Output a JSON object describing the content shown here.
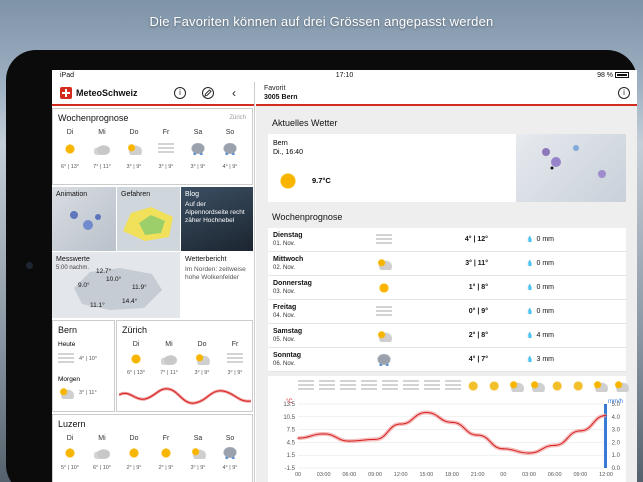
{
  "caption": "Die Favoriten können auf drei Grössen angepasst werden",
  "status": {
    "device": "iPad",
    "time": "17:10",
    "battery": "98 %"
  },
  "app": {
    "name": "MeteoSchweiz",
    "info_icon": "i",
    "edit_icon": "pencil-icon",
    "back_icon": "‹"
  },
  "wochenprognose": {
    "title": "Wochenprognose",
    "link": "Zürich",
    "days": [
      {
        "day": "Di",
        "icon": "sun",
        "temp": "6° | 13°"
      },
      {
        "day": "Mi",
        "icon": "cloud",
        "temp": "7° | 11°"
      },
      {
        "day": "Do",
        "icon": "sunc",
        "temp": "3° | 9°"
      },
      {
        "day": "Fr",
        "icon": "fog",
        "temp": "3° | 9°"
      },
      {
        "day": "Sa",
        "icon": "snow",
        "temp": "3° | 9°"
      },
      {
        "day": "So",
        "icon": "snow",
        "temp": "4° | 9°"
      }
    ]
  },
  "tiles": {
    "animation": "Animation",
    "gefahren": "Gefahren",
    "blog_title": "Blog",
    "blog_text": "Auf der Alpennordseite recht zäher Hochnebel",
    "messwerte": "Messwerte",
    "messwerte_time": "5:00 nachm.",
    "values": [
      "12.7°",
      "11.9°",
      "9.0°",
      "14.4°",
      "11.1°",
      "10.0°"
    ],
    "wetterbericht": "Wetterbericht",
    "wetterbericht_text": "Im Norden: zeitweise hohe Wolkenfelder"
  },
  "bern": {
    "title": "Bern",
    "heute": "Heute",
    "heute_temp": "4° | 10°",
    "morgen": "Morgen",
    "morgen_temp": "3° | 11°"
  },
  "zurich": {
    "title": "Zürich",
    "days": [
      "Di",
      "Mi",
      "Do",
      "Fr"
    ],
    "temps": [
      "6° | 13°",
      "7° | 11°",
      "3° | 9°",
      "3° | 9°"
    ]
  },
  "luzern": {
    "title": "Luzern",
    "days": [
      "Di",
      "Mi",
      "Do",
      "Fr",
      "Sa",
      "So"
    ],
    "temps": [
      "5° | 10°",
      "6° | 10°",
      "2° | 9°",
      "2° | 9°",
      "3° | 9°",
      "4° | 9°"
    ]
  },
  "right": {
    "fav_label": "Favorit",
    "fav_name": "3005 Bern",
    "aktuell_title": "Aktuelles Wetter",
    "aktuell_loc": "Bern",
    "aktuell_time": "Di., 16:40",
    "aktuell_temp": "9.7°C",
    "woche_title": "Wochenprognose",
    "rows": [
      {
        "day": "Dienstag",
        "date": "01. Nov.",
        "icon": "fog",
        "temp": "4° | 12°",
        "precip": "0 mm"
      },
      {
        "day": "Mittwoch",
        "date": "02. Nov.",
        "icon": "sunc",
        "temp": "3° | 11°",
        "precip": "0 mm"
      },
      {
        "day": "Donnerstag",
        "date": "03. Nov.",
        "icon": "sun",
        "temp": "1° | 8°",
        "precip": "0 mm"
      },
      {
        "day": "Freitag",
        "date": "04. Nov.",
        "icon": "fog",
        "temp": "0° | 9°",
        "precip": "0 mm"
      },
      {
        "day": "Samstag",
        "date": "05. Nov.",
        "icon": "sunc",
        "temp": "2° | 8°",
        "precip": "4 mm"
      },
      {
        "day": "Sonntag",
        "date": "06. Nov.",
        "icon": "snow",
        "temp": "4° | 7°",
        "precip": "3 mm"
      }
    ],
    "chart": {
      "unit_left": "°C",
      "unit_right": "mm/h",
      "yleft": [
        "13.5",
        "10.5",
        "7.5",
        "4.5",
        "1.5",
        "-1.5"
      ],
      "yright": [
        "5.0",
        "4.0",
        "3.0",
        "2.0",
        "1.0",
        "0.0"
      ],
      "xticks": [
        "00",
        "03:00",
        "06:00",
        "09:00",
        "12:00",
        "15:00",
        "18:00",
        "21:00",
        "00",
        "03:00",
        "06:00",
        "09:00",
        "12:00"
      ]
    }
  },
  "chart_data": {
    "type": "line",
    "x": [
      "00",
      "03:00",
      "06:00",
      "09:00",
      "12:00",
      "15:00",
      "18:00",
      "21:00",
      "00",
      "03:00",
      "06:00",
      "09:00",
      "12:00"
    ],
    "series": [
      {
        "values": [
          5.5,
          6.5,
          4.8,
          5.2,
          8.8,
          11.5,
          9.2,
          6.2,
          3.0,
          2.0,
          3.8,
          7.2,
          10.8
        ]
      }
    ],
    "ylim": [
      -1.5,
      13.5
    ]
  }
}
